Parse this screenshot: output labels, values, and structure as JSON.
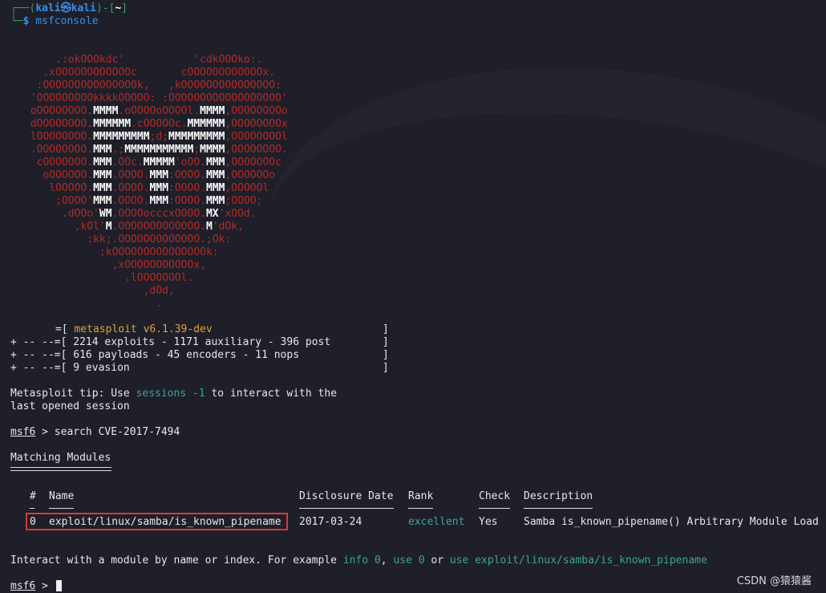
{
  "prompt": {
    "corner_top": "┌──(",
    "user": "kali㉿kali",
    "mid": ")-[",
    "dir": "~",
    "end": "]",
    "corner_bottom": "└─",
    "dollar": "$",
    "command": " msfconsole"
  },
  "banner": {
    "version": "metasploit v6.1.39-dev",
    "line1_prefix": "=[ ",
    "stats1": "2214 exploits - 1171 auxiliary - 396 post",
    "stats2": "616 payloads - 45 encoders - 11 nops",
    "stats3": "9 evasion",
    "plus_prefix": "+ -- --=[ ",
    "bracket_close": "]"
  },
  "tip": {
    "prefix": "Metasploit tip: Use ",
    "cmd": "sessions -1",
    "suffix": " to interact with the",
    "line2": "last opened session"
  },
  "search": {
    "prompt": "msf6",
    "command": " > search CVE-2017-7494"
  },
  "results": {
    "heading": "Matching Modules",
    "headers": {
      "num": "#",
      "name": "Name",
      "date": "Disclosure Date",
      "rank": "Rank",
      "check": "Check",
      "desc": "Description"
    },
    "rows": [
      {
        "num": "0",
        "name": "exploit/linux/samba/is_known_pipename",
        "date": "2017-03-24",
        "rank": "excellent",
        "check": "Yes",
        "desc": "Samba is_known_pipename() Arbitrary Module Load"
      }
    ]
  },
  "interact": {
    "p1": "Interact with a module by name or index. For example ",
    "info": "info 0",
    "sep": ", ",
    "use": "use 0",
    "or": " or ",
    "use_full": "use exploit/linux/samba/is_known_pipename"
  },
  "final_prompt": {
    "msf": "msf6",
    "gt": " > "
  },
  "watermark": "CSDN @猿猿酱",
  "colors": {
    "background": "#1e1f29",
    "prompt_blue": "#3a8ee6",
    "art_red": "#b22a28",
    "highlight_box": "#d83a3a",
    "teal": "#3aa59a"
  }
}
